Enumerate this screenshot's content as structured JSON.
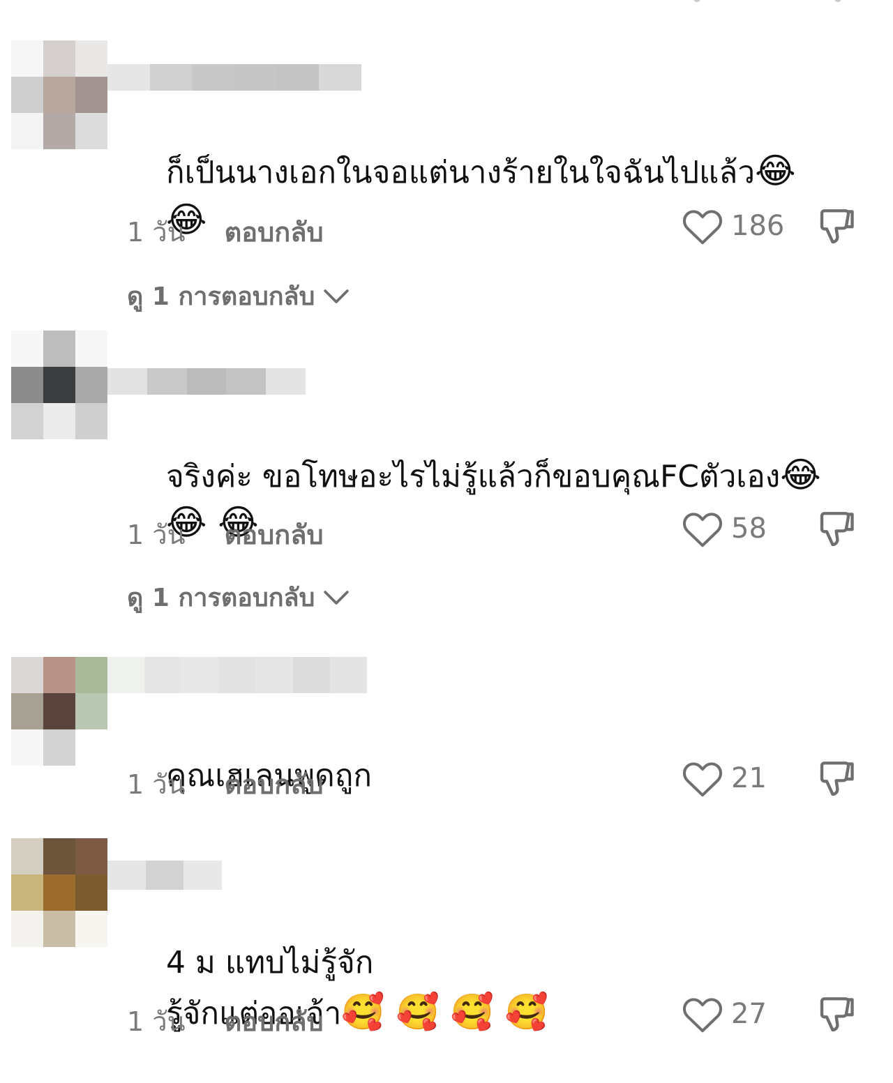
{
  "comments": [
    {
      "text": "ก็เป็นนางเอกในจอแต่นางร้ายในใจฉันไปแล้ว",
      "emojis_line1": "😂",
      "line2": "😂",
      "time": "1 วัน",
      "reply_label": "ตอบกลับ",
      "likes": "186",
      "view_replies": "ดู 1 การตอบกลับ"
    },
    {
      "text": "จริงค่ะ ขอโทษอะไรไม่รู้แล้วก็ขอบคุณFCตัวเอง",
      "emojis_line1": "😂",
      "line2": "😂 😂",
      "time": "1 วัน",
      "reply_label": "ตอบกลับ",
      "likes": "58",
      "view_replies": "ดู 1 การตอบกลับ"
    },
    {
      "text": "คุณเฮเลนพูดถูก",
      "time": "1 วัน",
      "reply_label": "ตอบกลับ",
      "likes": "21"
    },
    {
      "text": "4 ม แทบไม่รู้จัก",
      "line2_text": "รู้จักแต่ออเจ้า",
      "line2": "🥰 🥰 🥰 🥰",
      "time": "1 วัน",
      "reply_label": "ตอบกลับ",
      "likes": "27"
    }
  ],
  "icons": {
    "like": "heart-outline-icon",
    "dislike": "thumbs-down-outline-icon",
    "expand": "chevron-down-icon"
  },
  "colors": {
    "text": "#111111",
    "meta": "#7a7a7a",
    "icon": "#6f6f6f"
  }
}
